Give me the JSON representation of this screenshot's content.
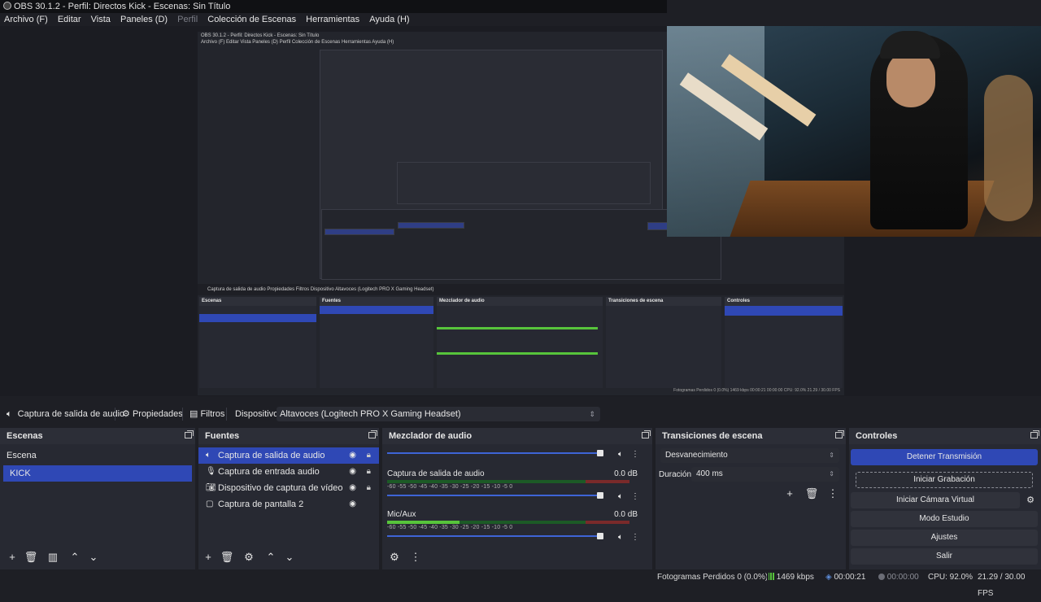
{
  "window": {
    "title": "OBS 30.1.2 - Perfil: Directos Kick - Escenas: Sin Título"
  },
  "menu": [
    "Archivo (F)",
    "Editar",
    "Vista",
    "Paneles (D)",
    "Perfil",
    "Colección de Escenas",
    "Herramientas",
    "Ayuda (H)"
  ],
  "nested_preview": {
    "title": "OBS 30.1.2 - Perfil: Directos Kick - Escenas: Sin Título",
    "menu": "Archivo (F)   Editar   Vista   Paneles (D)   Perfil   Colección de Escenas   Herramientas   Ayuda (H)",
    "props_bar": "Captura de salida de audio    Propiedades    Filtros    Dispositivo    Altavoces (Logitech PRO X Gaming Headset)",
    "docks": [
      "Escenas",
      "Fuentes",
      "Mezclador de audio",
      "Transiciones de escena",
      "Controles"
    ],
    "status": "Fotogramas Perdidos 0 (0.0%)    1469 kbps    00:00:21    00:00:00    CPU: 92.0%    21.29 / 30.00 FPS"
  },
  "context_bar": {
    "source_name": "Captura de salida de audio",
    "properties": "Propiedades",
    "filters": "Filtros",
    "device_label": "Dispositivo",
    "device_value": "Altavoces (Logitech PRO X Gaming Headset)"
  },
  "scenes": {
    "title": "Escenas",
    "items": [
      {
        "label": "Escena"
      },
      {
        "label": "KICK",
        "selected": true
      }
    ]
  },
  "sources": {
    "title": "Fuentes",
    "items": [
      {
        "label": "Captura de salida de audio",
        "icon": "speaker-icon",
        "selected": true
      },
      {
        "label": "Captura de entrada audio",
        "icon": "microphone-icon"
      },
      {
        "label": "Dispositivo de captura de vídeo",
        "icon": "camera-icon"
      },
      {
        "label": "Captura de pantalla 2",
        "icon": "monitor-icon"
      }
    ]
  },
  "mixer": {
    "title": "Mezclador de audio",
    "scale": "-60   -55   -50   -45   -40   -35   -30   -25   -20   -15   -10   -5   0",
    "tracks": [
      {
        "name": "Captura de salida de audio",
        "db": "0.0 dB",
        "level": 0
      },
      {
        "name": "Mic/Aux",
        "db": "0.0 dB",
        "level": 0.3
      }
    ]
  },
  "transitions": {
    "title": "Transiciones de escena",
    "selected": "Desvanecimiento",
    "duration_label": "Duración",
    "duration_value": "400 ms"
  },
  "controls": {
    "title": "Controles",
    "stop_stream": "Detener Transmisión",
    "start_recording": "Iniciar Grabación",
    "start_virtual_cam": "Iniciar Cámara Virtual",
    "studio_mode": "Modo Estudio",
    "settings": "Ajustes",
    "exit": "Salir"
  },
  "status": {
    "dropped_frames": "Fotogramas Perdidos 0 (0.0%)",
    "bitrate": "1469 kbps",
    "stream_time": "00:00:21",
    "rec_time": "00:00:00",
    "cpu": "CPU: 92.0%",
    "fps": "21.29 / 30.00 FPS"
  },
  "colors": {
    "accent": "#2f48b5",
    "meter_green": "#57c43b",
    "background": "#1e1f25"
  }
}
